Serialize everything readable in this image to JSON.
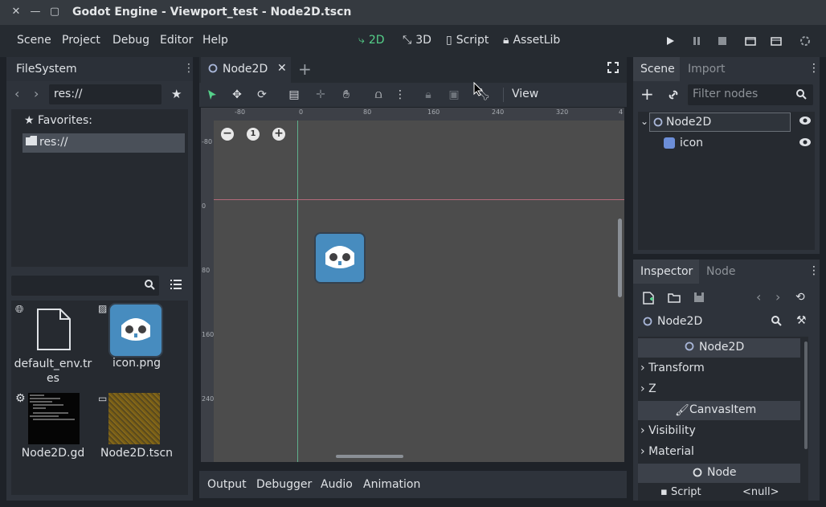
{
  "window": {
    "title": "Godot Engine - Viewport_test - Node2D.tscn"
  },
  "menu": {
    "scene": "Scene",
    "project": "Project",
    "debug": "Debug",
    "editor": "Editor",
    "help": "Help"
  },
  "workspaces": {
    "w2d": "2D",
    "w3d": "3D",
    "script": "Script",
    "assetlib": "AssetLib"
  },
  "filesystem": {
    "title": "FileSystem",
    "path": "res://",
    "favorites_label": "Favorites:",
    "root_label": "res://",
    "files": [
      {
        "name": "default_env.tres"
      },
      {
        "name": "icon.png"
      },
      {
        "name": "Node2D.gd"
      },
      {
        "name": "Node2D.tscn"
      }
    ]
  },
  "editor": {
    "tab": "Node2D",
    "view_menu": "View",
    "zoom_reset": "1",
    "ruler_top": [
      "-80",
      "0",
      "80",
      "160",
      "240",
      "320",
      "4"
    ],
    "ruler_left": [
      "-80",
      "0",
      "80",
      "160",
      "240"
    ]
  },
  "bottom_tabs": [
    "Output",
    "Debugger",
    "Audio",
    "Animation"
  ],
  "scene_dock": {
    "tab_scene": "Scene",
    "tab_import": "Import",
    "filter_placeholder": "Filter nodes",
    "tree": [
      {
        "name": "Node2D"
      },
      {
        "name": "icon"
      }
    ]
  },
  "inspector": {
    "tab_inspector": "Inspector",
    "tab_node": "Node",
    "object": "Node2D",
    "section_node2d": "Node2D",
    "transform": "Transform",
    "z": "Z",
    "section_canvasitem": "CanvasItem",
    "visibility": "Visibility",
    "material": "Material",
    "section_node": "Node",
    "script_label": "Script",
    "script_value": "<null>"
  },
  "colors": {
    "accent_2d": "#55d18a",
    "panel": "#2b3038",
    "viewport": "#4c4c4c",
    "godot_blue": "#478cbf"
  }
}
